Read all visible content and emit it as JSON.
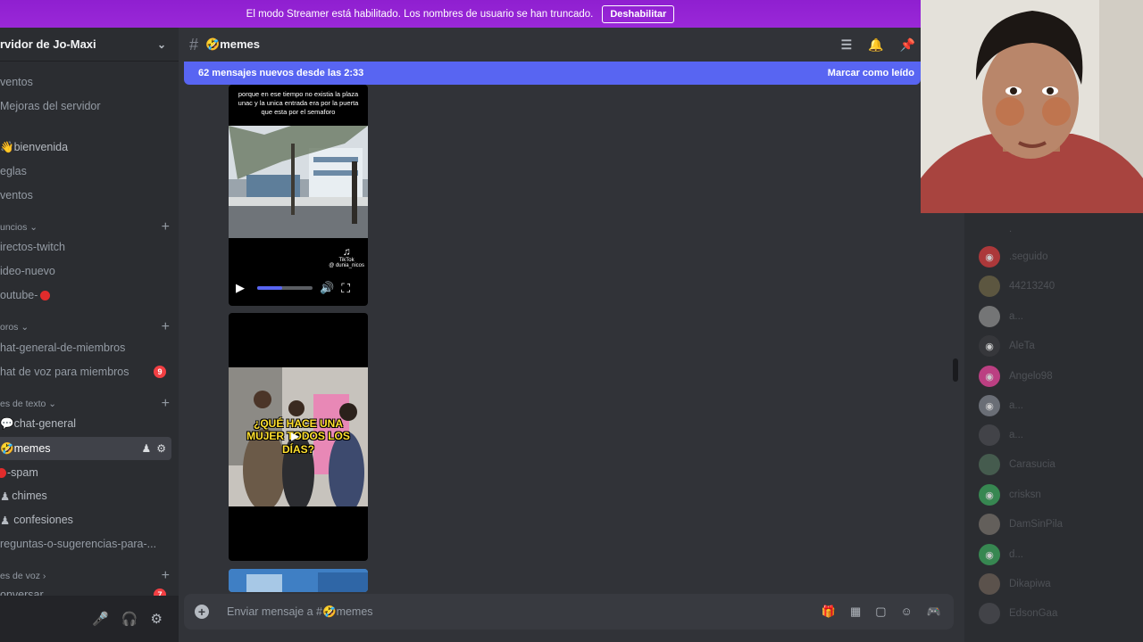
{
  "banner": {
    "text": "El modo Streamer está habilitado. Los nombres de usuario se han truncado.",
    "button": "Deshabilitar"
  },
  "server": {
    "name": "rvidor de Jo-Maxi"
  },
  "sidebar": {
    "items": [
      {
        "label": "ventos"
      },
      {
        "label": "Mejoras del servidor"
      },
      {
        "label": "👋bienvenida"
      },
      {
        "label": "eglas"
      },
      {
        "label": "ventos"
      },
      {
        "label": "irectos-twitch"
      },
      {
        "label": "ideo-nuevo"
      },
      {
        "label": "outube-"
      },
      {
        "label": "hat-general-de-miembros"
      },
      {
        "label": "hat de voz para miembros",
        "badge": "9"
      },
      {
        "label": "💬chat-general"
      },
      {
        "label": "🤣memes"
      },
      {
        "label": "-spam"
      },
      {
        "label": "chimes"
      },
      {
        "label": "confesiones"
      },
      {
        "label": "reguntas-o-sugerencias-para-..."
      },
      {
        "label": "onversar",
        "badge": "7"
      }
    ],
    "categories": [
      {
        "label": "uncios"
      },
      {
        "label": "oros"
      },
      {
        "label": "es de texto"
      },
      {
        "label": "es de voz"
      }
    ]
  },
  "channel": {
    "name": "🤣memes"
  },
  "new_messages": {
    "text": "62 mensajes nuevos desde las 2:33",
    "action": "Marcar como leído"
  },
  "videos": {
    "v1_text": "porque en ese tiempo no existia la plaza unac y la unica entrada era por la puerta que esta por el semaforo",
    "tiktok": "TikTok",
    "tiktok_user": "@ dunia_nicos",
    "v2_caption": "¿QUÉ HACE UNA MUJER TODOS LOS DÍAS?"
  },
  "composer": {
    "placeholder": "Enviar mensaje a #🤣memes"
  },
  "members": [
    {
      "name": "."
    },
    {
      "name": ".seguido"
    },
    {
      "name": "44213240"
    },
    {
      "name": "a..."
    },
    {
      "name": "AleTa"
    },
    {
      "name": "Angelo98"
    },
    {
      "name": "a..."
    },
    {
      "name": "a..."
    },
    {
      "name": "Carasucia"
    },
    {
      "name": "crisksn"
    },
    {
      "name": "DamSinPila"
    },
    {
      "name": "d..."
    },
    {
      "name": "Dikapiwa"
    },
    {
      "name": "EdsonGaa"
    }
  ],
  "colors": {
    "banner": "#9a28d8",
    "accent": "#5865f2",
    "badge": "#f23f43"
  }
}
